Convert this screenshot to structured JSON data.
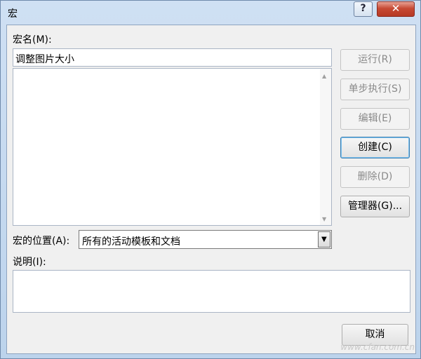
{
  "window": {
    "title": "宏",
    "help_label": "?",
    "close_label": "✕"
  },
  "macro_name": {
    "label": "宏名(M):",
    "value": "调整图片大小"
  },
  "buttons": {
    "run": "运行(R)",
    "step_into": "单步执行(S)",
    "edit": "编辑(E)",
    "create": "创建(C)",
    "delete": "删除(D)",
    "organizer": "管理器(G)...",
    "cancel": "取消"
  },
  "macros_in": {
    "label": "宏的位置(A):",
    "selected": "所有的活动模板和文档"
  },
  "description": {
    "label": "说明(I):",
    "value": ""
  },
  "watermark": "www.cfan.com.cn"
}
